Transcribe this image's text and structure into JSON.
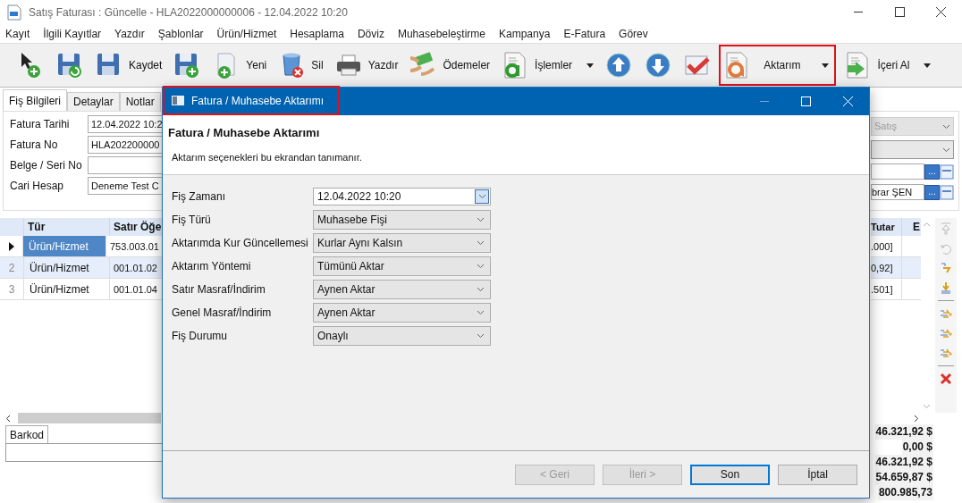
{
  "window": {
    "title": "Satış Faturası : Güncelle - HLA2022000000006 - 12.04.2022 10:20"
  },
  "menu": [
    "Kayıt",
    "İlgili Kayıtlar",
    "Yazdır",
    "Şablonlar",
    "Ürün/Hizmet",
    "Hesaplama",
    "Döviz",
    "Muhasebeleştirme",
    "Kampanya",
    "E-Fatura",
    "Görev"
  ],
  "toolbar": [
    {
      "kind": "cursor-plus",
      "dropdown": false,
      "highlighted": false
    },
    {
      "kind": "save-refresh",
      "dropdown": false,
      "highlighted": false
    },
    {
      "kind": "save",
      "label": "Kaydet",
      "dropdown": false,
      "highlighted": false
    },
    {
      "kind": "save-plus",
      "dropdown": false,
      "highlighted": false
    },
    {
      "kind": "page-plus",
      "label": "Yeni",
      "dropdown": false,
      "highlighted": false
    },
    {
      "kind": "trash",
      "label": "Sil",
      "dropdown": false,
      "highlighted": false
    },
    {
      "kind": "printer",
      "label": "Yazdır",
      "dropdown": false,
      "highlighted": false
    },
    {
      "kind": "money",
      "label": "Ödemeler",
      "dropdown": false,
      "highlighted": false
    },
    {
      "kind": "doc-a",
      "label": "İşlemler",
      "dropdown": true,
      "highlighted": false
    },
    {
      "kind": "up",
      "dropdown": false,
      "highlighted": false
    },
    {
      "kind": "down",
      "dropdown": false,
      "highlighted": false
    },
    {
      "kind": "check",
      "dropdown": false,
      "highlighted": false
    },
    {
      "kind": "doc-export",
      "label": "Aktarım",
      "dropdown": true,
      "highlighted": true
    },
    {
      "kind": "doc-import",
      "label": "İçeri Al",
      "dropdown": true,
      "highlighted": false
    }
  ],
  "tabs": [
    {
      "label": "Fiş Bilgileri",
      "selected": true
    },
    {
      "label": "Detaylar",
      "selected": false
    },
    {
      "label": "Notlar",
      "selected": false
    }
  ],
  "form_left": [
    {
      "label": "Fatura Tarihi",
      "value": "12.04.2022 10:2"
    },
    {
      "label": "Fatura No",
      "value": "HLA202200000"
    },
    {
      "label": "Belge / Seri No"
    },
    {
      "label": "Cari Hesap",
      "value": "Deneme Test C"
    }
  ],
  "form_right": [
    {
      "kind": "combo",
      "value": "Satış",
      "disabled": true
    },
    {
      "kind": "combo"
    },
    {
      "kind": "lookup",
      "button": "..."
    },
    {
      "kind": "lookup",
      "value": "brar ŞEN",
      "button": "..."
    }
  ],
  "grid": {
    "columns_left": [
      "Tür",
      "Satır Öğe"
    ],
    "columns_right": [
      "Tutar",
      "E"
    ],
    "rows": [
      {
        "current": true,
        "selected": false,
        "type": "Ürün/Hizmet",
        "item": "753.003.01",
        "amount": ".000]"
      },
      {
        "current": false,
        "number": "2",
        "selected": true,
        "type": "Ürün/Hizmet",
        "item": "001.01.02",
        "amount": "0,92]"
      },
      {
        "current": false,
        "number": "3",
        "selected": false,
        "type": "Ürün/Hizmet",
        "item": "001.01.04",
        "amount": ".501]"
      }
    ]
  },
  "side_tools": [
    {
      "kind": "up-top",
      "disabled": true
    },
    {
      "kind": "undo",
      "disabled": true
    },
    {
      "kind": "swap",
      "disabled": false
    },
    {
      "kind": "down-bottom",
      "disabled": false
    },
    {
      "kind": "add-1",
      "disabled": false
    },
    {
      "kind": "add-2",
      "disabled": false
    },
    {
      "kind": "add-3",
      "disabled": false
    },
    {
      "kind": "delete",
      "disabled": false
    }
  ],
  "bottom_tabs": [
    {
      "label": "Barkod",
      "selected": true
    }
  ],
  "totals": [
    "46.321,92 $",
    "0,00 $",
    "46.321,92 $",
    "54.659,87 $",
    "800.985,73"
  ],
  "dialog": {
    "title": "Fatura / Muhasebe Aktarımı",
    "title_highlighted": true,
    "heading": "Fatura / Muhasebe Aktarımı",
    "subtitle": "Aktarım seçenekleri bu ekrandan tanımanır.",
    "fields": [
      {
        "label": "Fiş Zamanı",
        "value": "12.04.2022 10:20",
        "kind": "date"
      },
      {
        "label": "Fiş Türü",
        "value": "Muhasebe Fişi",
        "kind": "combo"
      },
      {
        "label": "Aktarımda Kur Güncellemesi",
        "value": "Kurlar Aynı Kalsın",
        "kind": "combo"
      },
      {
        "label": "Aktarım Yöntemi",
        "value": "Tümünü Aktar",
        "kind": "combo"
      },
      {
        "label": "Satır Masraf/İndirim",
        "value": "Aynen Aktar",
        "kind": "combo"
      },
      {
        "label": "Genel Masraf/İndirim",
        "value": "Aynen Aktar",
        "kind": "combo"
      },
      {
        "label": "Fiş Durumu",
        "value": "Onaylı",
        "kind": "combo"
      }
    ],
    "buttons": [
      {
        "label": "< Geri",
        "disabled": true,
        "default": false
      },
      {
        "label": "İleri >",
        "disabled": true,
        "default": false
      },
      {
        "label": "Son",
        "disabled": false,
        "default": true
      },
      {
        "label": "İptal",
        "disabled": false,
        "default": false
      }
    ]
  }
}
